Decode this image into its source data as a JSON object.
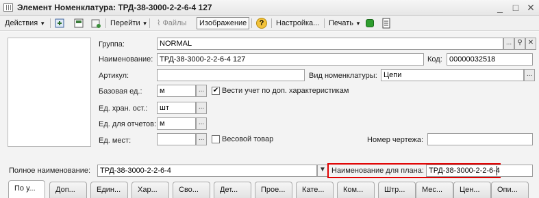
{
  "window": {
    "title": "Элемент Номенклатура: ТРД-38-3000-2-2-6-4 127",
    "buttons": {
      "minimize": "_",
      "maximize": "□",
      "close": "✕"
    }
  },
  "toolbar": {
    "actions": "Действия",
    "goto": "Перейти",
    "files": "Файлы",
    "image": "Изображение",
    "help": "?",
    "settings": "Настройка...",
    "print": "Печать"
  },
  "form": {
    "group_label": "Группа:",
    "group_value": "NORMAL",
    "name_label": "Наименование:",
    "name_value": "ТРД-38-3000-2-2-6-4 127",
    "code_label": "Код:",
    "code_value": "00000032518",
    "article_label": "Артикул:",
    "article_value": "",
    "kind_label": "Вид номенклатуры:",
    "kind_value": "Цепи",
    "base_unit_label": "Базовая ед.:",
    "base_unit_value": "м",
    "track_features_label": "Вести учет по доп. характеристикам",
    "track_features_checked": true,
    "storage_unit_label": "Ед. хран. ост.:",
    "storage_unit_value": "шт",
    "report_unit_label": "Ед. для отчетов:",
    "report_unit_value": "м",
    "place_unit_label": "Ед. мест:",
    "place_unit_value": "",
    "weight_label": "Весовой товар",
    "weight_checked": false,
    "drawing_label": "Номер чертежа:",
    "drawing_value": "",
    "full_name_label": "Полное наименование:",
    "full_name_value": "ТРД-38-3000-2-2-6-4",
    "plan_name_label": "Наименование для плана:",
    "plan_name_value": "ТРД-38-3000-2-2-6-4",
    "select_glyph": "...",
    "dropdown_glyph": "▼",
    "clear_glyph": "✕",
    "check_glyph": "✔"
  },
  "tabs": [
    "По у...",
    "Доп...",
    "Един...",
    "Хар...",
    "Сво...",
    "Дет...",
    "Прое...",
    "Кате...",
    "Ком...",
    "Штр...",
    "Мес...",
    "Цен...",
    "Опи..."
  ],
  "colors": {
    "highlight_box": "#e00000",
    "toolbar_bg": "#f0f0f0",
    "form_bg": "#f3f3f3"
  }
}
